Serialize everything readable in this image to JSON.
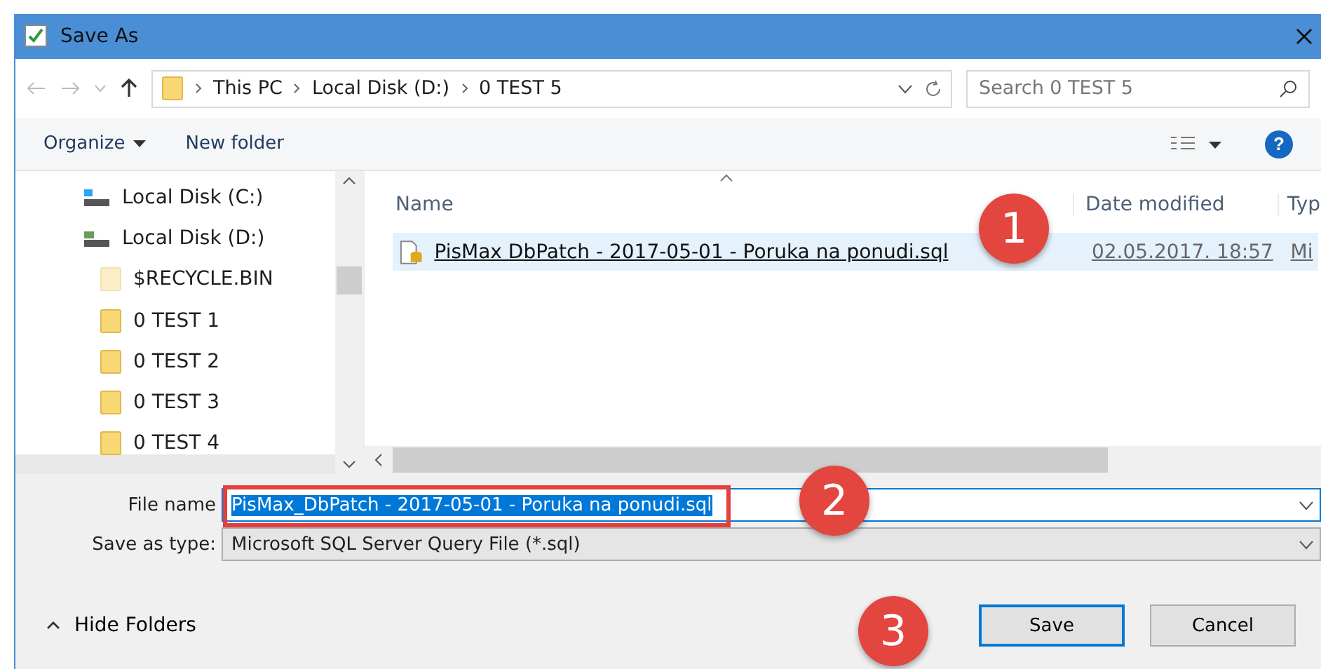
{
  "window": {
    "title": "Save As"
  },
  "address": {
    "segments": [
      "This PC",
      "Local Disk (D:)",
      "0 TEST 5"
    ]
  },
  "search": {
    "placeholder": "Search 0 TEST 5"
  },
  "toolbar": {
    "organize": "Organize",
    "new_folder": "New folder",
    "help": "?"
  },
  "sidebar": {
    "items": [
      {
        "label": "Local Disk (C:)",
        "kind": "drive-system"
      },
      {
        "label": "Local Disk (D:)",
        "kind": "drive",
        "children": [
          {
            "label": "$RECYCLE.BIN",
            "kind": "hidden-folder"
          },
          {
            "label": "0 TEST 1",
            "kind": "folder"
          },
          {
            "label": "0 TEST 2",
            "kind": "folder"
          },
          {
            "label": "0 TEST 3",
            "kind": "folder"
          },
          {
            "label": "0 TEST 4",
            "kind": "folder"
          }
        ]
      }
    ]
  },
  "file_list": {
    "columns": [
      "Name",
      "Date modified",
      "Typ"
    ],
    "rows": [
      {
        "name": "PisMax DbPatch - 2017-05-01 - Poruka na ponudi.sql",
        "date": "02.05.2017. 18:57",
        "type": "Mi",
        "selected": true
      }
    ]
  },
  "form": {
    "file_name_label": "File name",
    "file_name": "PisMax_DbPatch - 2017-05-01 - Poruka na ponudi.sql",
    "type_label": "Save as type:",
    "type": "Microsoft SQL Server Query File (*.sql)"
  },
  "footer": {
    "hide_folders": "Hide Folders",
    "save": "Save",
    "cancel": "Cancel"
  },
  "callouts": [
    "1",
    "2",
    "3"
  ]
}
